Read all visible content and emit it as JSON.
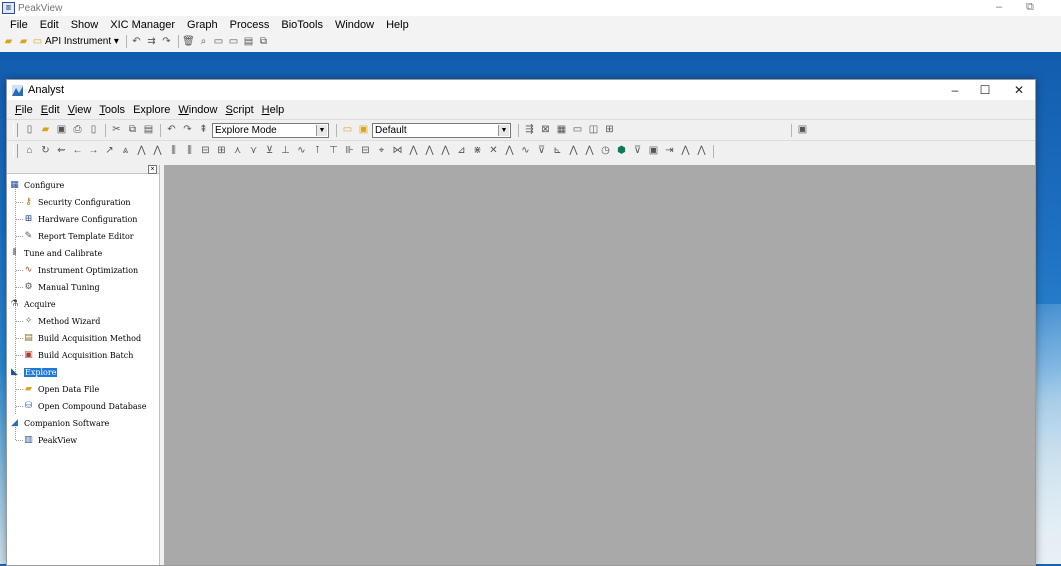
{
  "peakview": {
    "title": "PeakView",
    "menu": [
      "File",
      "Edit",
      "Show",
      "XIC Manager",
      "Graph",
      "Process",
      "BioTools",
      "Window",
      "Help"
    ],
    "instrument_label": "API Instrument"
  },
  "analyst": {
    "title": "Analyst",
    "menu": [
      {
        "u": "F",
        "rest": "ile"
      },
      {
        "u": "E",
        "rest": "dit"
      },
      {
        "u": "V",
        "rest": "iew"
      },
      {
        "u": "T",
        "rest": "ools"
      },
      {
        "u": "",
        "rest": "Explore"
      },
      {
        "u": "W",
        "rest": "indow"
      },
      {
        "u": "S",
        "rest": "cript"
      },
      {
        "u": "H",
        "rest": "elp"
      }
    ],
    "mode_select": "Explore Mode",
    "project_select": "Default",
    "tree": [
      {
        "label": "Configure",
        "icon": "configure-icon",
        "glyph": "▦",
        "color": "#2b4e9b"
      },
      {
        "label": "Security Configuration",
        "icon": "key-icon",
        "glyph": "⚷",
        "color": "#a77c0d"
      },
      {
        "label": "Hardware Configuration",
        "icon": "hardware-icon",
        "glyph": "⊞",
        "color": "#2b4e9b"
      },
      {
        "label": "Report Template Editor",
        "icon": "report-template-icon",
        "glyph": "✎",
        "color": "#555"
      },
      {
        "label": "Tune and Calibrate",
        "icon": "tune-icon",
        "glyph": "⫴",
        "color": "#444"
      },
      {
        "label": "Instrument Optimization",
        "icon": "optimization-icon",
        "glyph": "∿",
        "color": "#c0392b"
      },
      {
        "label": "Manual Tuning",
        "icon": "manual-tuning-icon",
        "glyph": "⚙",
        "color": "#555"
      },
      {
        "label": "Acquire",
        "icon": "acquire-icon",
        "glyph": "⚗",
        "color": "#444"
      },
      {
        "label": "Method Wizard",
        "icon": "wand-icon",
        "glyph": "✧",
        "color": "#555"
      },
      {
        "label": "Build Acquisition Method",
        "icon": "method-icon",
        "glyph": "▤",
        "color": "#8a6d1f"
      },
      {
        "label": "Build Acquisition Batch",
        "icon": "batch-icon",
        "glyph": "▣",
        "color": "#b03a2e"
      },
      {
        "label": "Explore",
        "icon": "explore-icon",
        "glyph": "◣",
        "color": "#2b4e9b"
      },
      {
        "label": "Open Data File",
        "icon": "folder-icon",
        "glyph": "▰",
        "color": "#d9a520"
      },
      {
        "label": "Open Compound Database",
        "icon": "database-icon",
        "glyph": "⛁",
        "color": "#2b6cb0"
      },
      {
        "label": "Companion Software",
        "icon": "companion-icon",
        "glyph": "◢",
        "color": "#2b6cb0"
      },
      {
        "label": "PeakView",
        "icon": "peakview-icon",
        "glyph": "▥",
        "color": "#2b4e9b"
      }
    ]
  }
}
